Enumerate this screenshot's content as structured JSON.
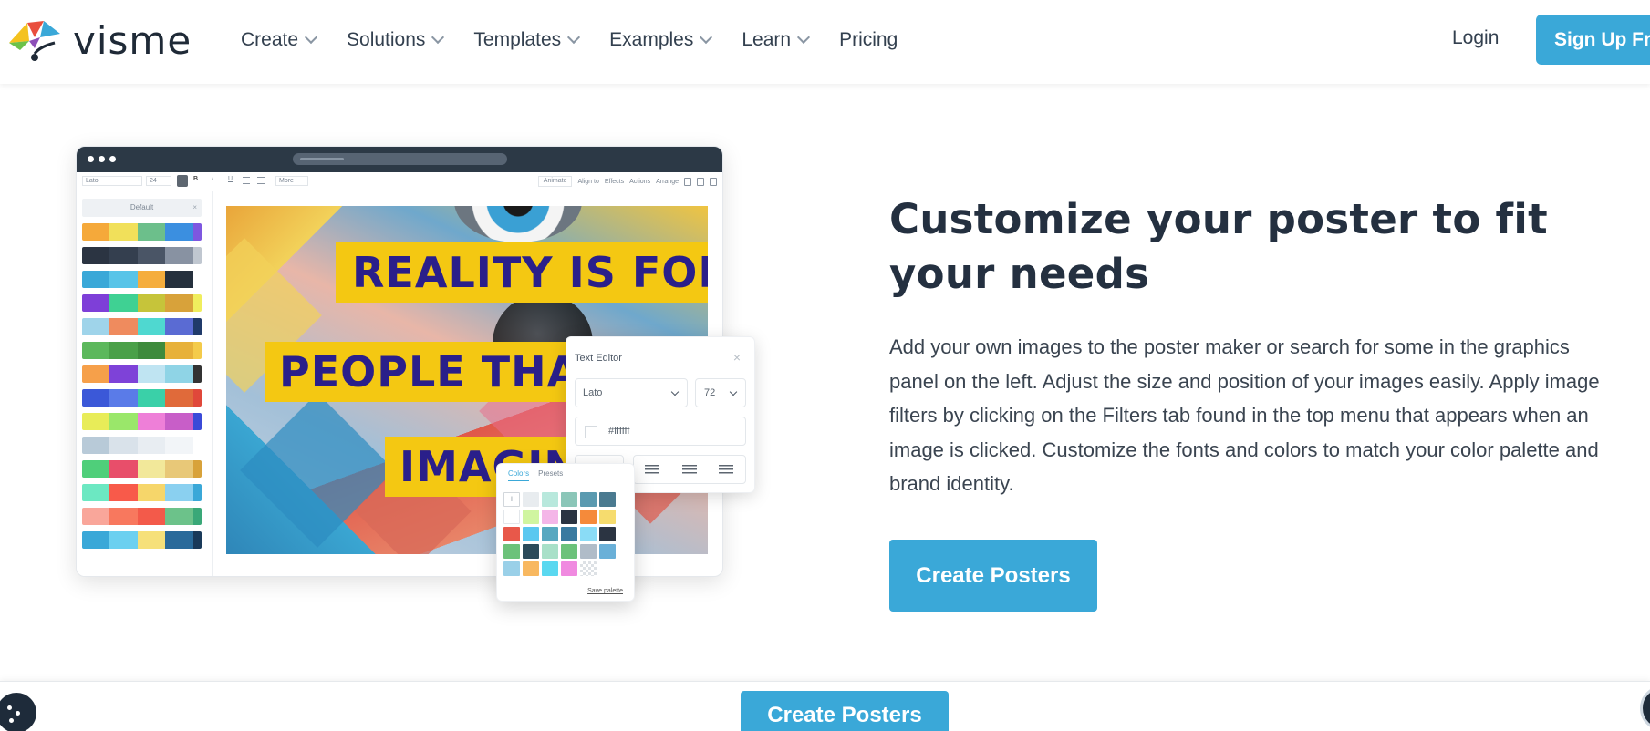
{
  "brand": {
    "name": "visme",
    "accent": "#3aa8d8",
    "dark": "#243040"
  },
  "nav": {
    "items": [
      {
        "label": "Create",
        "has_dropdown": true
      },
      {
        "label": "Solutions",
        "has_dropdown": true
      },
      {
        "label": "Templates",
        "has_dropdown": true
      },
      {
        "label": "Examples",
        "has_dropdown": true
      },
      {
        "label": "Learn",
        "has_dropdown": true
      },
      {
        "label": "Pricing",
        "has_dropdown": false
      }
    ],
    "login": "Login",
    "signup": "Sign Up Free"
  },
  "mockup": {
    "toolbar": {
      "font": "Lato",
      "size": "24",
      "bold": "B",
      "italic": "I",
      "underline": "U",
      "more": "More",
      "animate": "Animate",
      "align": "Align to",
      "effects": "Effects",
      "actions": "Actions",
      "arrange": "Arrange"
    },
    "side_panel_label": "Default",
    "side_close": "×",
    "poster_lines": [
      "REALITY IS FOR",
      "PEOPLE THAT",
      "IMAGINE"
    ],
    "text_editor": {
      "title": "Text Editor",
      "close": "×",
      "font": "Lato",
      "size": "72",
      "color": "#ffffff",
      "bold": "B"
    },
    "color_picker": {
      "tab_colors": "Colors",
      "tab_presets": "Presets",
      "add": "+",
      "save": "Save palette"
    }
  },
  "content": {
    "headline": "Customize your poster to fit your needs",
    "paragraph": "Add your own images to the poster maker or search for some in the graphics panel on the left. Adjust the size and position of your images easily. Apply image filters by clicking on the Filters tab found in the top menu that appears when an image is clicked. Customize the fonts and colors to match your color palette and brand identity.",
    "cta": "Create Posters"
  },
  "sticky_bar": {
    "cta": "Create Posters"
  }
}
